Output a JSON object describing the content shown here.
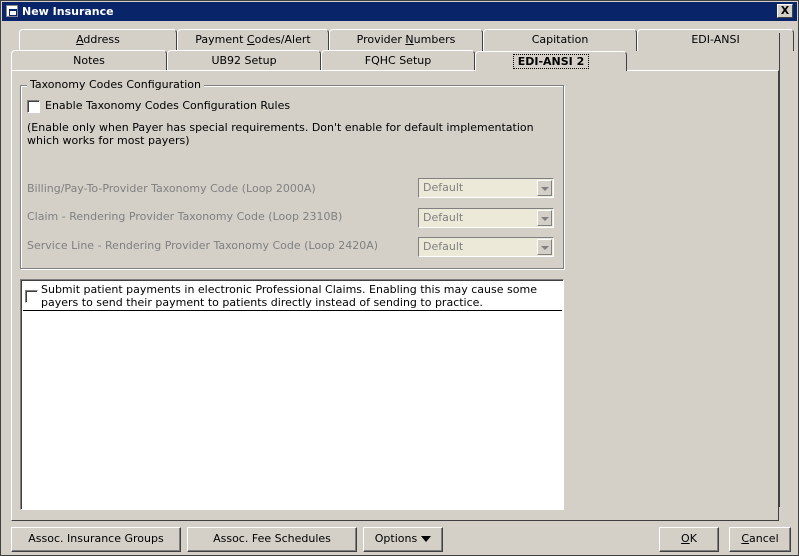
{
  "window": {
    "title": "New Insurance",
    "close_label": "X"
  },
  "tabs_row1": [
    {
      "pre": "",
      "ul": "A",
      "post": "ddress"
    },
    {
      "pre": "Payment ",
      "ul": "C",
      "post": "odes/Alert"
    },
    {
      "pre": "Provider ",
      "ul": "N",
      "post": "umbers"
    },
    {
      "pre": "Capitation",
      "ul": "",
      "post": ""
    },
    {
      "pre": "EDI-ANSI",
      "ul": "",
      "post": ""
    }
  ],
  "tabs_row2": [
    {
      "label": "Notes"
    },
    {
      "label": "UB92 Setup"
    },
    {
      "label": "FQHC Setup"
    },
    {
      "label": "EDI-ANSI 2"
    }
  ],
  "taxonomy": {
    "legend": "Taxonomy Codes Configuration",
    "enable_label": "Enable Taxonomy Codes Configuration Rules",
    "note_line1": "(Enable only when Payer has special requirements.  Don't enable for default implementation",
    "note_line2": "which works for most payers)",
    "fields": [
      {
        "label": "Billing/Pay-To-Provider Taxonomy Code (Loop 2000A)",
        "value": "Default"
      },
      {
        "label": "Claim - Rendering Provider Taxonomy Code (Loop 2310B)",
        "value": "Default"
      },
      {
        "label": "Service Line - Rendering Provider Taxonomy Code (Loop 2420A)",
        "value": "Default"
      }
    ]
  },
  "submit": {
    "line1": "Submit patient payments in electronic Professional Claims.  Enabling this may cause some",
    "line2": "payers to send their payment to patients directly instead of sending to practice."
  },
  "buttons": {
    "assoc_groups": "Assoc. Insurance Groups",
    "assoc_fees": "Assoc. Fee Schedules",
    "options": "Options",
    "ok_ul": "O",
    "ok_rest": "K",
    "cancel_ul": "C",
    "cancel_rest": "ancel"
  }
}
